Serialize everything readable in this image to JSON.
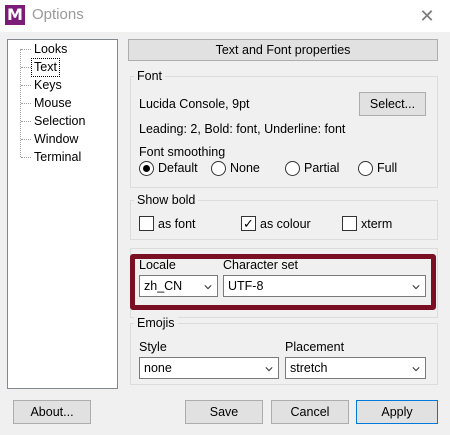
{
  "window": {
    "title": "Options",
    "icon_letter": "M",
    "close_glyph": "✕"
  },
  "tree": {
    "items": [
      "Looks",
      "Text",
      "Keys",
      "Mouse",
      "Selection",
      "Window",
      "Terminal"
    ],
    "selected": "Text"
  },
  "panel_title": "Text and Font properties",
  "font_group": {
    "label": "Font",
    "font_name": "Lucida Console, 9pt",
    "select_button": "Select...",
    "details": "Leading: 2, Bold: font, Underline: font",
    "smoothing_label": "Font smoothing",
    "smoothing_options": [
      "Default",
      "None",
      "Partial",
      "Full"
    ],
    "smoothing_selected": "Default"
  },
  "show_bold": {
    "label": "Show bold",
    "options": [
      "as font",
      "as colour",
      "xterm"
    ],
    "checked": [
      "as colour"
    ]
  },
  "locale": {
    "locale_label": "Locale",
    "locale_value": "zh_CN",
    "charset_label": "Character set",
    "charset_value": "UTF-8",
    "highlight_color": "#7a0e22"
  },
  "emojis": {
    "label": "Emojis",
    "style_label": "Style",
    "style_value": "none",
    "placement_label": "Placement",
    "placement_value": "stretch"
  },
  "buttons": {
    "about": "About...",
    "save": "Save",
    "cancel": "Cancel",
    "apply": "Apply"
  }
}
